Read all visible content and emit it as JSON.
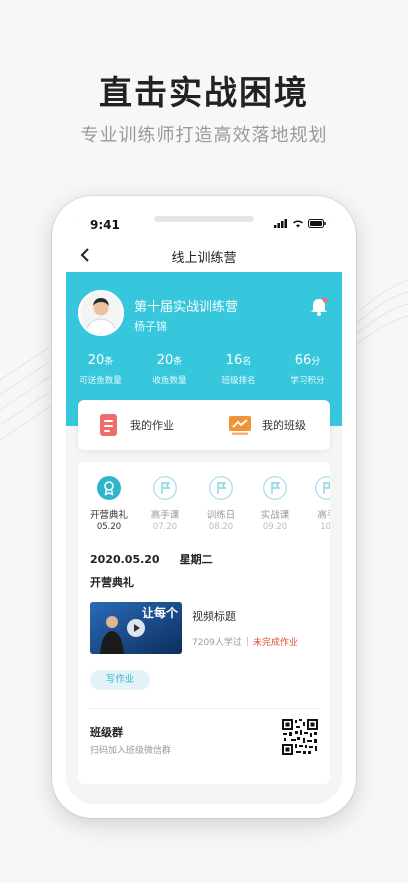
{
  "promo": {
    "title": "直击实战困境",
    "subtitle": "专业训练师打造高效落地规划"
  },
  "status_bar": {
    "time": "9:41"
  },
  "nav": {
    "title": "线上训练营",
    "back_icon": "chevron-left-icon"
  },
  "profile": {
    "camp_name": "第十届实战训练营",
    "user_name": "杨子锦",
    "bell_icon": "bell-icon",
    "stats": [
      {
        "value": "20",
        "unit": "条",
        "label": "可送鱼数量"
      },
      {
        "value": "20",
        "unit": "条",
        "label": "收鱼数量"
      },
      {
        "value": "16",
        "unit": "名",
        "label": "班级排名"
      },
      {
        "value": "66",
        "unit": "分",
        "label": "学习积分"
      }
    ]
  },
  "actions": {
    "homework": {
      "label": "我的作业",
      "icon": "homework-document-icon",
      "color": "#f26b6b"
    },
    "class": {
      "label": "我的班级",
      "icon": "class-chart-icon",
      "color": "#f2933a"
    }
  },
  "timeline": [
    {
      "name": "开营典礼",
      "date": "05.20",
      "icon": "award-icon",
      "active": true
    },
    {
      "name": "高手课",
      "date": "07.20",
      "icon": "flag-icon"
    },
    {
      "name": "训练日",
      "date": "08.20",
      "icon": "flag-icon"
    },
    {
      "name": "实战课",
      "date": "09.20",
      "icon": "flag-icon"
    },
    {
      "name": "高手",
      "date": "10.",
      "icon": "flag-icon"
    }
  ],
  "detail": {
    "date": "2020.05.20",
    "weekday": "星期二",
    "event_title": "开营典礼",
    "video": {
      "thumb_text": "让每个",
      "title": "视频标题",
      "learners": "7209人学过",
      "status": "未完成作业"
    },
    "write_button": "写作业",
    "group": {
      "title": "班级群",
      "desc": "扫码加入班级微信群",
      "qr_icon": "qr-code-icon"
    }
  },
  "colors": {
    "accent": "#36c7dc",
    "warning": "#e0503a",
    "button_bg": "#e3f4f9"
  }
}
